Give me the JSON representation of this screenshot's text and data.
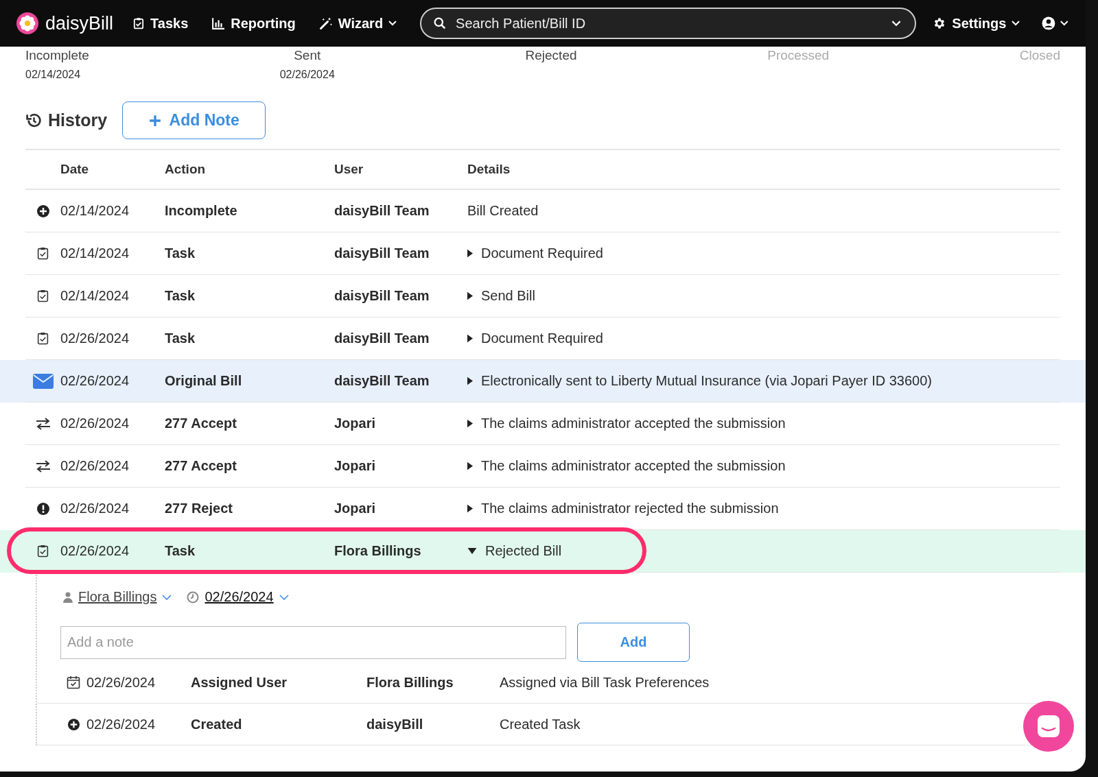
{
  "nav": {
    "brand": "daisyBill",
    "items": [
      {
        "label": "Tasks",
        "kind": "tasks",
        "caret": false
      },
      {
        "label": "Reporting",
        "kind": "chart",
        "caret": false
      },
      {
        "label": "Wizard",
        "kind": "wand",
        "caret": true
      }
    ],
    "search": {
      "placeholder": "Search Patient/Bill ID"
    },
    "settings": {
      "label": "Settings"
    }
  },
  "status_steps": [
    {
      "label": "Incomplete",
      "date": "02/14/2024",
      "reached": true
    },
    {
      "label": "Sent",
      "date": "02/26/2024",
      "reached": true
    },
    {
      "label": "Rejected",
      "reached": true
    },
    {
      "label": "Processed",
      "reached": false
    },
    {
      "label": "Closed",
      "reached": false
    }
  ],
  "history": {
    "title": "History",
    "add_note_button": "Add Note",
    "columns": [
      "Date",
      "Action",
      "User",
      "Details"
    ],
    "rows": [
      {
        "kind": "plus",
        "date": "02/14/2024",
        "action": "Incomplete",
        "user": "daisyBill Team",
        "details": "Bill Created",
        "highlighted": false,
        "selected": false,
        "circled": false
      },
      {
        "kind": "task",
        "date": "02/14/2024",
        "action": "Task",
        "user": "daisyBill Team",
        "details": "Document Required",
        "expanded": false,
        "highlighted": false,
        "selected": false,
        "circled": false
      },
      {
        "kind": "task",
        "date": "02/14/2024",
        "action": "Task",
        "user": "daisyBill Team",
        "details": "Send Bill",
        "expanded": false,
        "highlighted": false,
        "selected": false,
        "circled": false
      },
      {
        "kind": "task",
        "date": "02/26/2024",
        "action": "Task",
        "user": "daisyBill Team",
        "details": "Document Required",
        "expanded": false,
        "highlighted": false,
        "selected": false,
        "circled": false
      },
      {
        "kind": "mail",
        "date": "02/26/2024",
        "action": "Original Bill",
        "user": "daisyBill Team",
        "details": "Electronically sent to Liberty Mutual Insurance (via Jopari Payer ID 33600)",
        "expanded": false,
        "highlighted": true,
        "selected": false,
        "circled": false
      },
      {
        "kind": "exchange",
        "date": "02/26/2024",
        "action": "277 Accept",
        "user": "Jopari",
        "details": "The claims administrator accepted the submission",
        "expanded": false,
        "highlighted": false,
        "selected": false,
        "circled": false
      },
      {
        "kind": "exchange",
        "date": "02/26/2024",
        "action": "277 Accept",
        "user": "Jopari",
        "details": "The claims administrator accepted the submission",
        "expanded": false,
        "highlighted": false,
        "selected": false,
        "circled": false
      },
      {
        "kind": "alert",
        "date": "02/26/2024",
        "action": "277 Reject",
        "user": "Jopari",
        "details": "The claims administrator rejected the submission",
        "expanded": false,
        "highlighted": false,
        "selected": false,
        "circled": false
      },
      {
        "kind": "task",
        "date": "02/26/2024",
        "action": "Task",
        "user": "Flora Billings",
        "details": "Rejected Bill",
        "expanded": true,
        "highlighted": false,
        "selected": true,
        "circled": true
      }
    ]
  },
  "task_detail": {
    "assignee": "Flora Billings",
    "due_date": "02/26/2024",
    "note": {
      "placeholder": "Add a note"
    },
    "add_button": "Add",
    "rows": [
      {
        "kind": "calendar",
        "date": "02/26/2024",
        "action": "Assigned User",
        "user": "Flora Billings",
        "details": "Assigned via Bill Task Preferences"
      },
      {
        "kind": "plus",
        "date": "02/26/2024",
        "action": "Created",
        "user": "daisyBill",
        "details": "Created Task"
      }
    ]
  }
}
